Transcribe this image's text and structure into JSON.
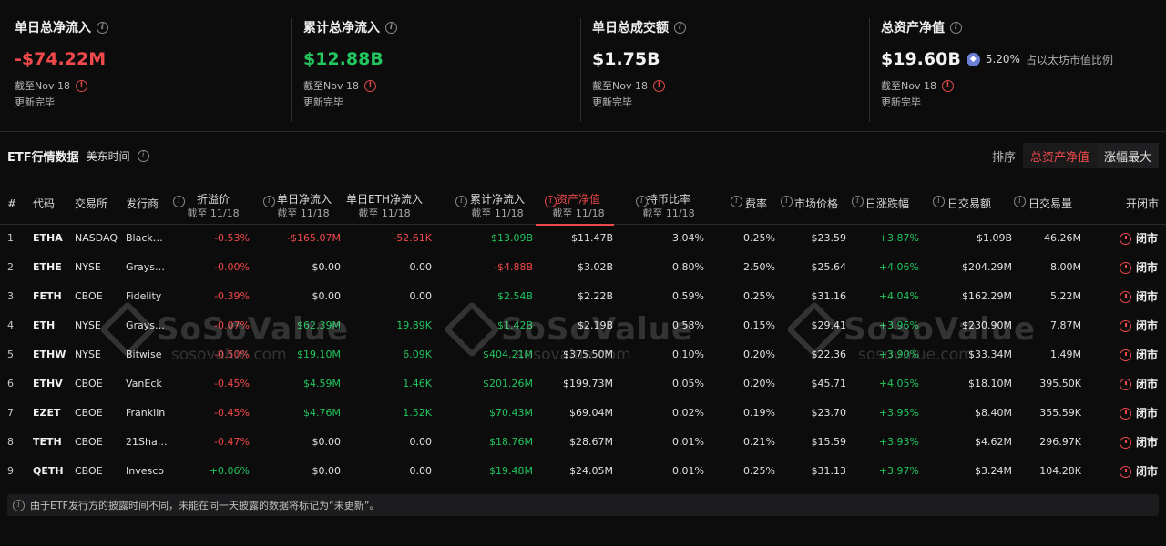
{
  "stats": [
    {
      "label": "单日总净流入",
      "value": "-$74.22M",
      "tone": "neg",
      "date": "截至Nov 18",
      "status": "更新完毕"
    },
    {
      "label": "累计总净流入",
      "value": "$12.88B",
      "tone": "pos",
      "date": "截至Nov 18",
      "status": "更新完毕"
    },
    {
      "label": "单日总成交额",
      "value": "$1.75B",
      "tone": "white",
      "date": "截至Nov 18",
      "status": "更新完毕"
    },
    {
      "label": "总资产净值",
      "value": "$19.60B",
      "tone": "white",
      "date": "截至Nov 18",
      "status": "更新完毕",
      "eth_pct": "5.20%",
      "eth_note": "占以太坊市值比例"
    }
  ],
  "section": {
    "title": "ETF行情数据",
    "timezone": "美东时间"
  },
  "sort": {
    "label": "排序",
    "options": [
      "总资产净值",
      "涨幅最大"
    ]
  },
  "columns": {
    "idx": "#",
    "code": "代码",
    "exchange": "交易所",
    "issuer": "发行商",
    "premium": "折溢价",
    "premium_sub": "截至 11/18",
    "daily_flow": "单日净流入",
    "daily_flow_sub": "截至 11/18",
    "daily_eth": "单日ETH净流入",
    "daily_eth_sub": "截至 11/18",
    "cum_flow": "累计净流入",
    "cum_flow_sub": "截至 11/18",
    "nav": "资产净值",
    "nav_sub": "截至 11/18",
    "hold_ratio": "持币比率",
    "hold_ratio_sub": "截至 11/18",
    "fee": "费率",
    "price": "市场价格",
    "change": "日涨跌幅",
    "volume": "日交易额",
    "shares": "日交易量",
    "status": "开闭市"
  },
  "rows": [
    {
      "idx": "1",
      "code": "ETHA",
      "exchange": "NASDAQ",
      "issuer": "Black…",
      "premium": "-0.53%",
      "daily_flow": "-$165.07M",
      "daily_eth": "-52.61K",
      "cum_flow": "$13.09B",
      "nav": "$11.47B",
      "hold_ratio": "3.04%",
      "fee": "0.25%",
      "price": "$23.59",
      "change": "+3.87%",
      "volume": "$1.09B",
      "shares": "46.26M",
      "status": "闭市"
    },
    {
      "idx": "2",
      "code": "ETHE",
      "exchange": "NYSE",
      "issuer": "Grays…",
      "premium": "-0.00%",
      "daily_flow": "$0.00",
      "daily_eth": "0.00",
      "cum_flow": "-$4.88B",
      "nav": "$3.02B",
      "hold_ratio": "0.80%",
      "fee": "2.50%",
      "price": "$25.64",
      "change": "+4.06%",
      "volume": "$204.29M",
      "shares": "8.00M",
      "status": "闭市"
    },
    {
      "idx": "3",
      "code": "FETH",
      "exchange": "CBOE",
      "issuer": "Fidelity",
      "premium": "-0.39%",
      "daily_flow": "$0.00",
      "daily_eth": "0.00",
      "cum_flow": "$2.54B",
      "nav": "$2.22B",
      "hold_ratio": "0.59%",
      "fee": "0.25%",
      "price": "$31.16",
      "change": "+4.04%",
      "volume": "$162.29M",
      "shares": "5.22M",
      "status": "闭市"
    },
    {
      "idx": "4",
      "code": "ETH",
      "exchange": "NYSE",
      "issuer": "Grays…",
      "premium": "-0.07%",
      "daily_flow": "$62.39M",
      "daily_eth": "19.89K",
      "cum_flow": "$1.42B",
      "nav": "$2.19B",
      "hold_ratio": "0.58%",
      "fee": "0.15%",
      "price": "$29.41",
      "change": "+3.96%",
      "volume": "$230.90M",
      "shares": "7.87M",
      "status": "闭市"
    },
    {
      "idx": "5",
      "code": "ETHW",
      "exchange": "NYSE",
      "issuer": "Bitwise",
      "premium": "-0.50%",
      "daily_flow": "$19.10M",
      "daily_eth": "6.09K",
      "cum_flow": "$404.21M",
      "nav": "$375.50M",
      "hold_ratio": "0.10%",
      "fee": "0.20%",
      "price": "$22.36",
      "change": "+3.90%",
      "volume": "$33.34M",
      "shares": "1.49M",
      "status": "闭市"
    },
    {
      "idx": "6",
      "code": "ETHV",
      "exchange": "CBOE",
      "issuer": "VanEck",
      "premium": "-0.45%",
      "daily_flow": "$4.59M",
      "daily_eth": "1.46K",
      "cum_flow": "$201.26M",
      "nav": "$199.73M",
      "hold_ratio": "0.05%",
      "fee": "0.20%",
      "price": "$45.71",
      "change": "+4.05%",
      "volume": "$18.10M",
      "shares": "395.50K",
      "status": "闭市"
    },
    {
      "idx": "7",
      "code": "EZET",
      "exchange": "CBOE",
      "issuer": "Franklin",
      "premium": "-0.45%",
      "daily_flow": "$4.76M",
      "daily_eth": "1.52K",
      "cum_flow": "$70.43M",
      "nav": "$69.04M",
      "hold_ratio": "0.02%",
      "fee": "0.19%",
      "price": "$23.70",
      "change": "+3.95%",
      "volume": "$8.40M",
      "shares": "355.59K",
      "status": "闭市"
    },
    {
      "idx": "8",
      "code": "TETH",
      "exchange": "CBOE",
      "issuer": "21Sha…",
      "premium": "-0.47%",
      "daily_flow": "$0.00",
      "daily_eth": "0.00",
      "cum_flow": "$18.76M",
      "nav": "$28.67M",
      "hold_ratio": "0.01%",
      "fee": "0.21%",
      "price": "$15.59",
      "change": "+3.93%",
      "volume": "$4.62M",
      "shares": "296.97K",
      "status": "闭市"
    },
    {
      "idx": "9",
      "code": "QETH",
      "exchange": "CBOE",
      "issuer": "Invesco",
      "premium": "+0.06%",
      "daily_flow": "$0.00",
      "daily_eth": "0.00",
      "cum_flow": "$19.48M",
      "nav": "$24.05M",
      "hold_ratio": "0.01%",
      "fee": "0.25%",
      "price": "$31.13",
      "change": "+3.97%",
      "volume": "$3.24M",
      "shares": "104.28K",
      "status": "闭市"
    }
  ],
  "watermark": {
    "brand": "SoSoValue",
    "url": "sosovalue.com"
  },
  "note": "由于ETF发行方的披露时间不同，未能在同一天披露的数据将标记为“未更新”。",
  "colors": {
    "negative": "#f0494b",
    "positive": "#22c55e",
    "accent": "#f0494b",
    "background": "#0c0c0d"
  }
}
